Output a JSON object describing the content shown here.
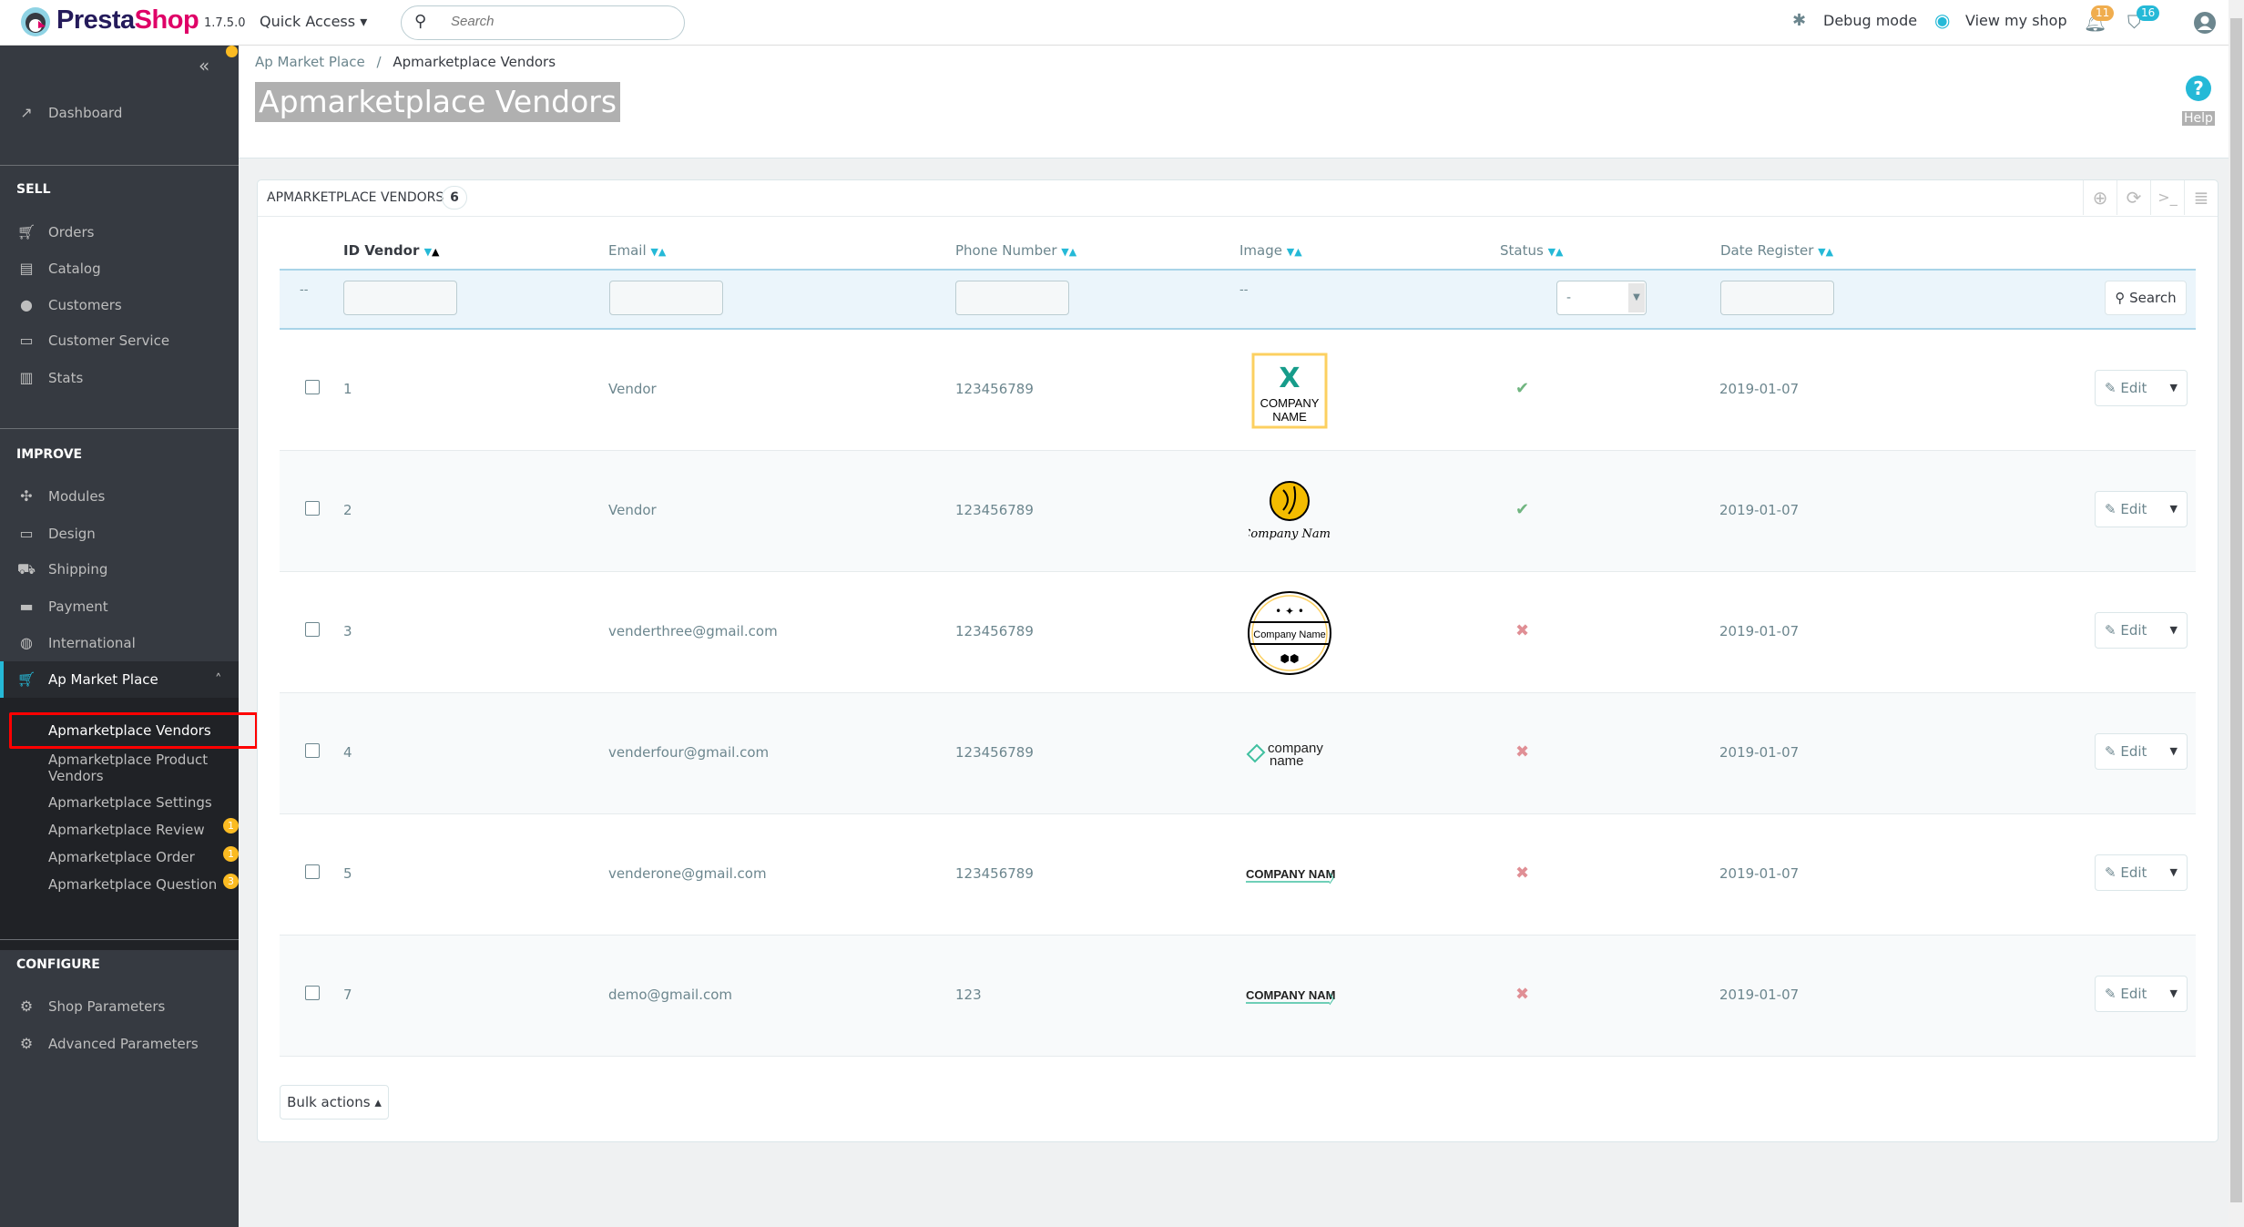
{
  "header": {
    "brand": "PrestaShop",
    "brand_part1": "Presta",
    "brand_part2": "Shop",
    "version": "1.7.5.0",
    "quick_access": "Quick Access",
    "search_placeholder": "Search",
    "debug_mode": "Debug mode",
    "view_shop": "View my shop",
    "notifications_count": "11",
    "orders_count": "16"
  },
  "breadcrumb": {
    "parent": "Ap Market Place",
    "separator": "/",
    "current": "Apmarketplace Vendors"
  },
  "page_title": "Apmarketplace Vendors",
  "help_label": "Help",
  "sidebar": {
    "dashboard": "Dashboard",
    "sell_title": "SELL",
    "sell": [
      "Orders",
      "Catalog",
      "Customers",
      "Customer Service",
      "Stats"
    ],
    "improve_title": "IMPROVE",
    "improve": [
      "Modules",
      "Design",
      "Shipping",
      "Payment",
      "International",
      "Ap Market Place"
    ],
    "submenu": [
      {
        "label": "Apmarketplace Vendors"
      },
      {
        "label": "Apmarketplace Product Vendors"
      },
      {
        "label": "Apmarketplace Settings"
      },
      {
        "label": "Apmarketplace Review",
        "badge": "1"
      },
      {
        "label": "Apmarketplace Order",
        "badge": "1"
      },
      {
        "label": "Apmarketplace Question",
        "badge": "3"
      }
    ],
    "configure_title": "CONFIGURE",
    "configure": [
      "Shop Parameters",
      "Advanced Parameters"
    ]
  },
  "panel": {
    "title": "APMARKETPLACE VENDORS",
    "count": "6",
    "columns": [
      "ID Vendor",
      "Email",
      "Phone Number",
      "Image",
      "Status",
      "Date Register"
    ],
    "filter_placeholder_dash": "--",
    "status_filter": "-",
    "search_button": "Search",
    "edit_label": "Edit",
    "bulk_actions": "Bulk actions",
    "rows": [
      {
        "id": "1",
        "email": "Vendor",
        "phone": "123456789",
        "logo": "company-name-x",
        "logo_text": "COMPANY NAME",
        "status": true,
        "date": "2019-01-07"
      },
      {
        "id": "2",
        "email": "Vendor",
        "phone": "123456789",
        "logo": "company-name-cat",
        "logo_text": "Company Name",
        "status": true,
        "date": "2019-01-07"
      },
      {
        "id": "3",
        "email": "venderthree@gmail.com",
        "phone": "123456789",
        "logo": "company-name-badge",
        "logo_text": "Company Name",
        "status": false,
        "date": "2019-01-07"
      },
      {
        "id": "4",
        "email": "venderfour@gmail.com",
        "phone": "123456789",
        "logo": "company-name-tag",
        "logo_text": "company name",
        "status": false,
        "date": "2019-01-07"
      },
      {
        "id": "5",
        "email": "venderone@gmail.com",
        "phone": "123456789",
        "logo": "company-name-plain",
        "logo_text": "COMPANY NAME",
        "status": false,
        "date": "2019-01-07"
      },
      {
        "id": "7",
        "email": "demo@gmail.com",
        "phone": "123",
        "logo": "company-name-plain",
        "logo_text": "COMPANY NAME",
        "status": false,
        "date": "2019-01-07"
      }
    ]
  },
  "colors": {
    "sidebar": "#363a41",
    "submenu": "#202226",
    "accent": "#25b9d7",
    "enabled": "#70b580",
    "disabled": "#e08f95",
    "highlight": "#ff0000"
  }
}
